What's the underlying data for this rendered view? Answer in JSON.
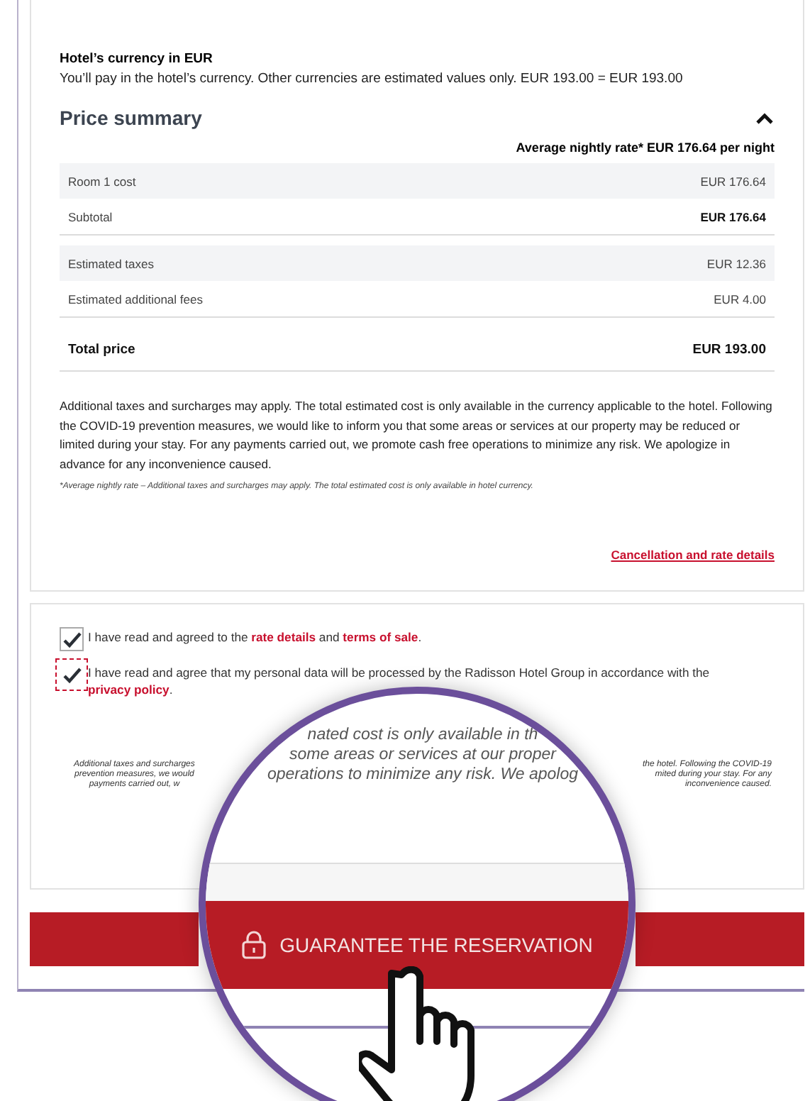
{
  "currency": {
    "title": "Hotel’s currency in EUR",
    "text": "You’ll pay in the hotel’s currency. Other currencies are estimated values only. EUR 193.00 = EUR 193.00"
  },
  "price_summary": {
    "title": "Price summary",
    "expanded": true,
    "average_rate": "Average nightly rate* EUR 176.64 per night",
    "groups": [
      [
        {
          "label": "Room 1 cost",
          "value": "EUR 176.64",
          "kind": "item"
        },
        {
          "label": "Subtotal",
          "value": "EUR 176.64",
          "kind": "subtotal"
        }
      ],
      [
        {
          "label": "Estimated taxes",
          "value": "EUR 12.36",
          "kind": "item"
        },
        {
          "label": "Estimated additional fees",
          "value": "EUR 4.00",
          "kind": "item"
        }
      ],
      [
        {
          "label": "Total price",
          "value": "EUR 193.00",
          "kind": "total"
        }
      ]
    ],
    "notice": "Additional taxes and surcharges may apply. The total estimated cost is only available in the currency applicable to the hotel. Following the COVID-19 prevention measures, we would like to inform you that some areas or services at our property may be reduced or limited during your stay. For any payments carried out, we promote cash free operations to minimize any risk. We apologize in advance for any inconvenience caused.",
    "footnote": "*Average nightly rate – Additional taxes and surcharges may apply. The total estimated cost is only available in hotel currency.",
    "link": "Cancellation and rate details"
  },
  "consents": [
    {
      "checked": true,
      "highlighted": false,
      "parts": [
        {
          "text": "I have read and agreed to the "
        },
        {
          "text": "rate details",
          "link": true
        },
        {
          "text": " and "
        },
        {
          "text": "terms of sale",
          "link": true
        },
        {
          "text": "."
        }
      ]
    },
    {
      "checked": true,
      "highlighted": true,
      "parts": [
        {
          "text": "I have read and agree that my personal data will be processed by the Radisson Hotel Group in accordance with the "
        },
        {
          "text": "privacy policy",
          "link": true
        },
        {
          "text": "."
        }
      ]
    }
  ],
  "fine_print": {
    "left_lines": [
      "Additional taxes and surcharges",
      "prevention measures, we would",
      "payments carried out, w"
    ],
    "right_lines": [
      "the hotel. Following the COVID-19",
      "mited during your stay. For any",
      "inconvenience caused."
    ]
  },
  "magnifier": {
    "lines": [
      "nated cost is only available in th",
      "some areas or services at our proper",
      "operations to minimize any risk. We apolog"
    ],
    "button": "GUARANTEE THE RESERVATION"
  }
}
